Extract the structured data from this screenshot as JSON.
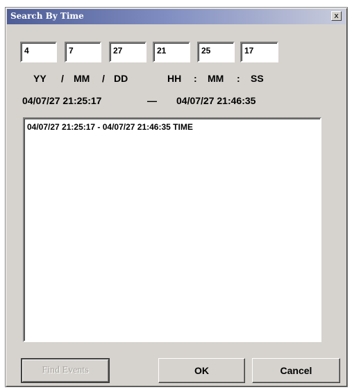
{
  "dialog": {
    "title": "Search By Time",
    "close_label": "x"
  },
  "fields": {
    "year": "4",
    "month": "7",
    "day": "27",
    "hour": "21",
    "minute": "25",
    "second": "17"
  },
  "format_labels": {
    "yy": "YY",
    "sep1": "/",
    "mm": "MM",
    "sep2": "/",
    "dd": "DD",
    "hh": "HH",
    "sep3": ":",
    "min": "MM",
    "sep4": ":",
    "ss": "SS"
  },
  "range": {
    "start": "04/07/27  21:25:17",
    "dash": "—",
    "end": "04/07/27  21:46:35"
  },
  "results": [
    "04/07/27  21:25:17 - 04/07/27  21:46:35  TIME"
  ],
  "buttons": {
    "find_events": "Find Events",
    "ok": "OK",
    "cancel": "Cancel"
  }
}
